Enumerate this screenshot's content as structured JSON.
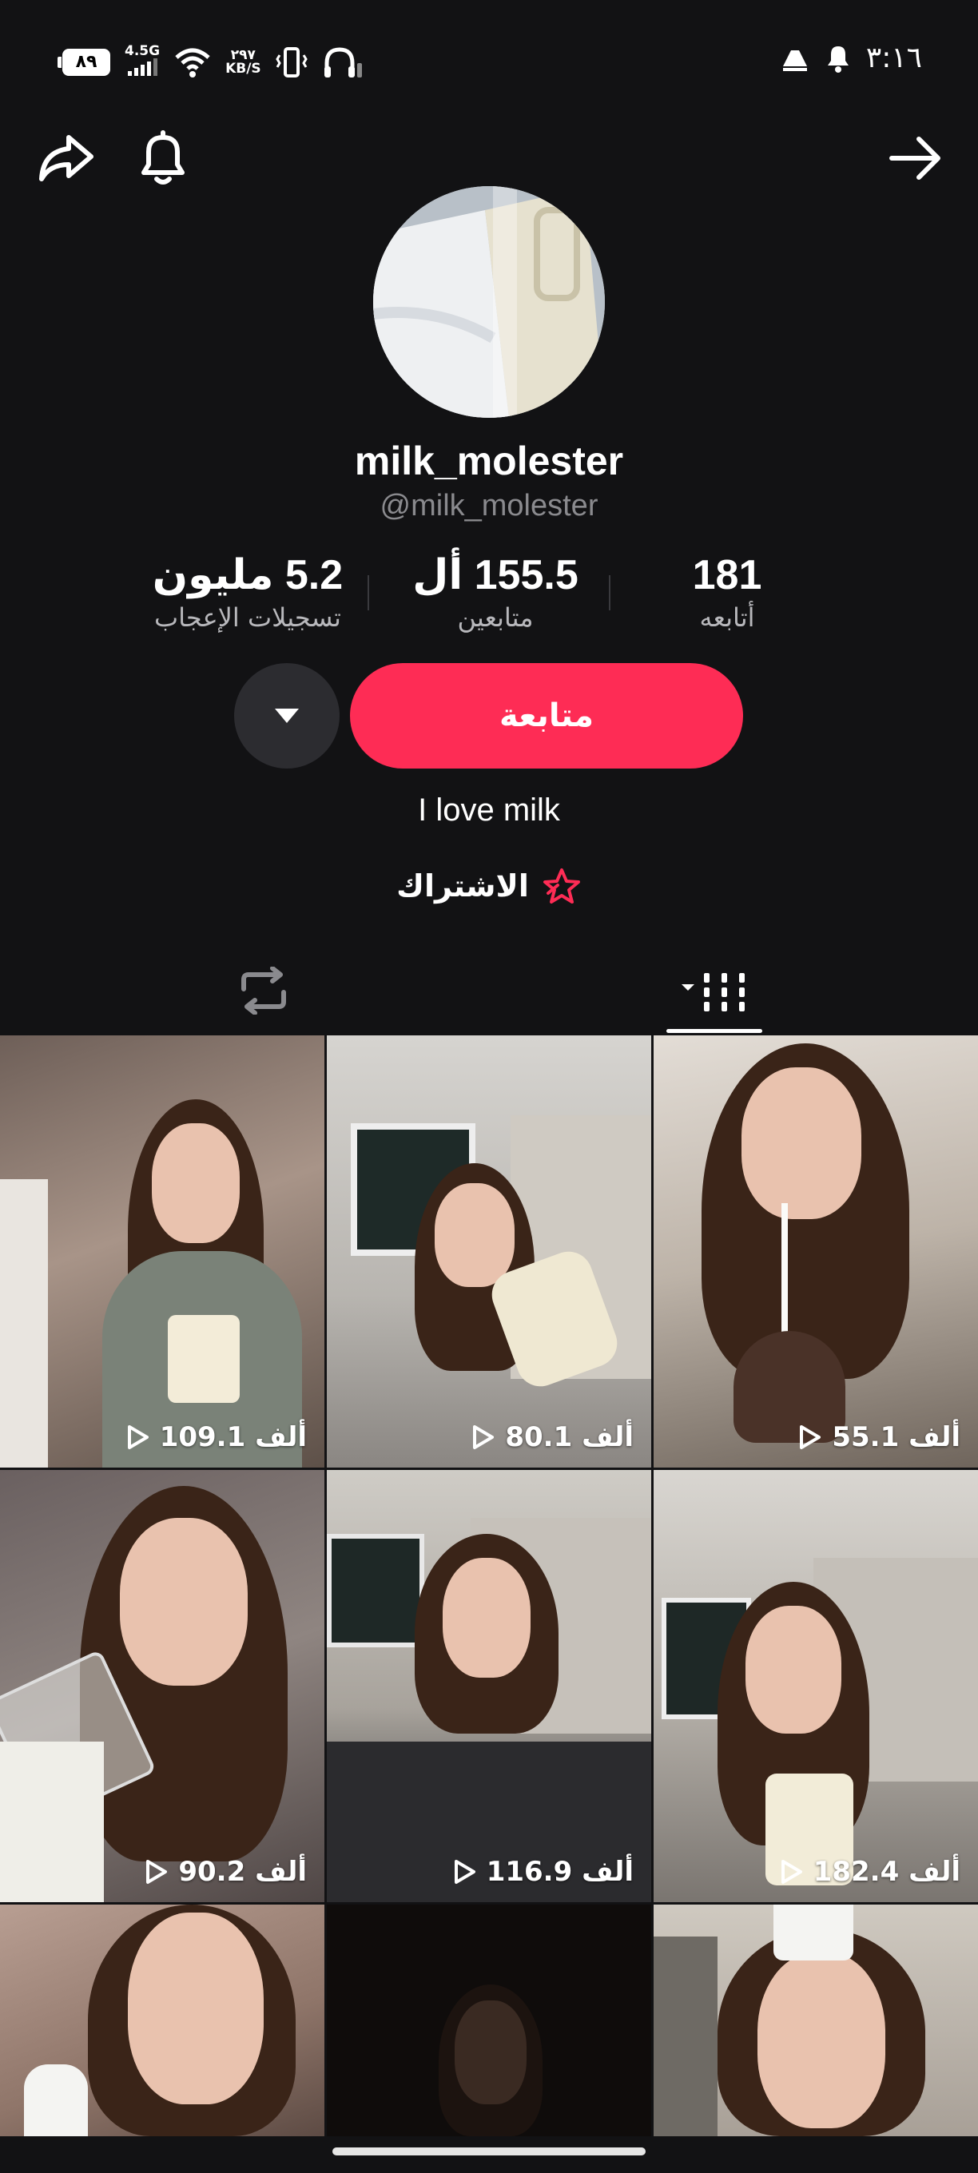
{
  "status_bar": {
    "battery": "٨٩",
    "network": "4.5G",
    "speed_value": "٢٩٧",
    "speed_unit": "KB/S",
    "time": "٣:١٦"
  },
  "profile": {
    "display_name": "milk_molester",
    "handle": "@milk_molester",
    "bio": "I love milk"
  },
  "stats": [
    {
      "value": "181",
      "label": "أتابعه"
    },
    {
      "value": "155.5 أل",
      "label": "متابعين"
    },
    {
      "value": "5.2 مليون",
      "label": "تسجيلات الإعجاب"
    }
  ],
  "actions": {
    "follow_label": "متابعة",
    "subscribe_label": "الاشتراك"
  },
  "icons": {
    "top_left": [
      "share-icon",
      "bell-icon"
    ],
    "top_right": "arrow-right-icon",
    "tabs": [
      "repost-icon",
      "videos-grid-icon"
    ]
  },
  "colors": {
    "background": "#121214",
    "accent": "#fe2c55"
  },
  "videos": [
    {
      "views": "109.1 ألف"
    },
    {
      "views": "80.1 ألف"
    },
    {
      "views": "55.1 ألف"
    },
    {
      "views": "90.2 ألف"
    },
    {
      "views": "116.9 ألف"
    },
    {
      "views": "182.4 ألف"
    },
    {
      "views": ""
    },
    {
      "views": ""
    },
    {
      "views": ""
    }
  ]
}
